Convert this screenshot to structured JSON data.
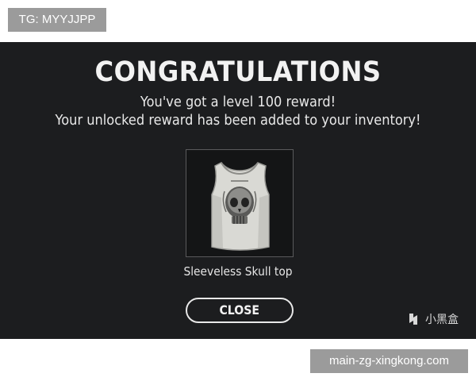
{
  "watermark_top": "TG: MYYJJPP",
  "dialog": {
    "title": "CONGRATULATIONS",
    "message_line1": "You've got a level 100 reward!",
    "message_line2": "Your unlocked reward has been added to your inventory!",
    "reward": {
      "name": "Sleeveless Skull top",
      "icon": "sleeveless-skull-top-image"
    },
    "close_label": "CLOSE"
  },
  "brand_logo": {
    "text": "小黑盒",
    "icon": "xiaoheihe-logo-icon"
  },
  "watermark_bottom": "main-zg-xingkong.com",
  "colors": {
    "panel_bg": "#1c1d1f",
    "text": "#f2f2f2",
    "watermark_bg": "#9b9b9b"
  }
}
